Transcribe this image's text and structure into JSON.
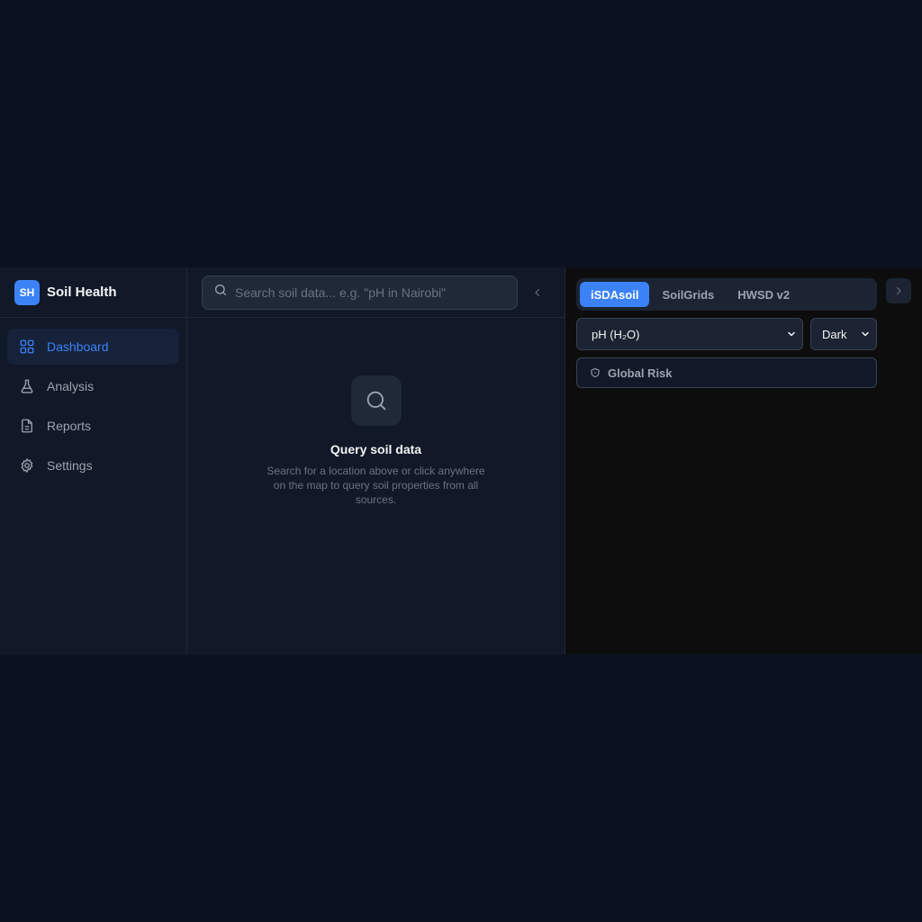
{
  "brand": {
    "logo": "SH",
    "name": "Soil Health"
  },
  "nav": {
    "items": [
      {
        "label": "Dashboard",
        "icon": "grid-icon",
        "active": true
      },
      {
        "label": "Analysis",
        "icon": "flask-icon",
        "active": false
      },
      {
        "label": "Reports",
        "icon": "document-icon",
        "active": false
      },
      {
        "label": "Settings",
        "icon": "gear-icon",
        "active": false
      }
    ]
  },
  "search": {
    "placeholder": "Search soil data... e.g. \"pH in Nairobi\"",
    "value": ""
  },
  "empty_state": {
    "title": "Query soil data",
    "description": "Search for a location above or click anywhere on the map to query soil properties from all sources."
  },
  "map": {
    "tabs": [
      {
        "label": "iSDAsoil",
        "active": true
      },
      {
        "label": "SoilGrids",
        "active": false
      },
      {
        "label": "HWSD v2",
        "active": false
      }
    ],
    "layer_select": "pH (H₂O)",
    "theme_select": "Dark",
    "risk_button": "Global Risk"
  },
  "colors": {
    "accent": "#3b82f6",
    "background": "#0b1120",
    "sidebar": "#111827",
    "map_bg": "#0d0d0d"
  }
}
